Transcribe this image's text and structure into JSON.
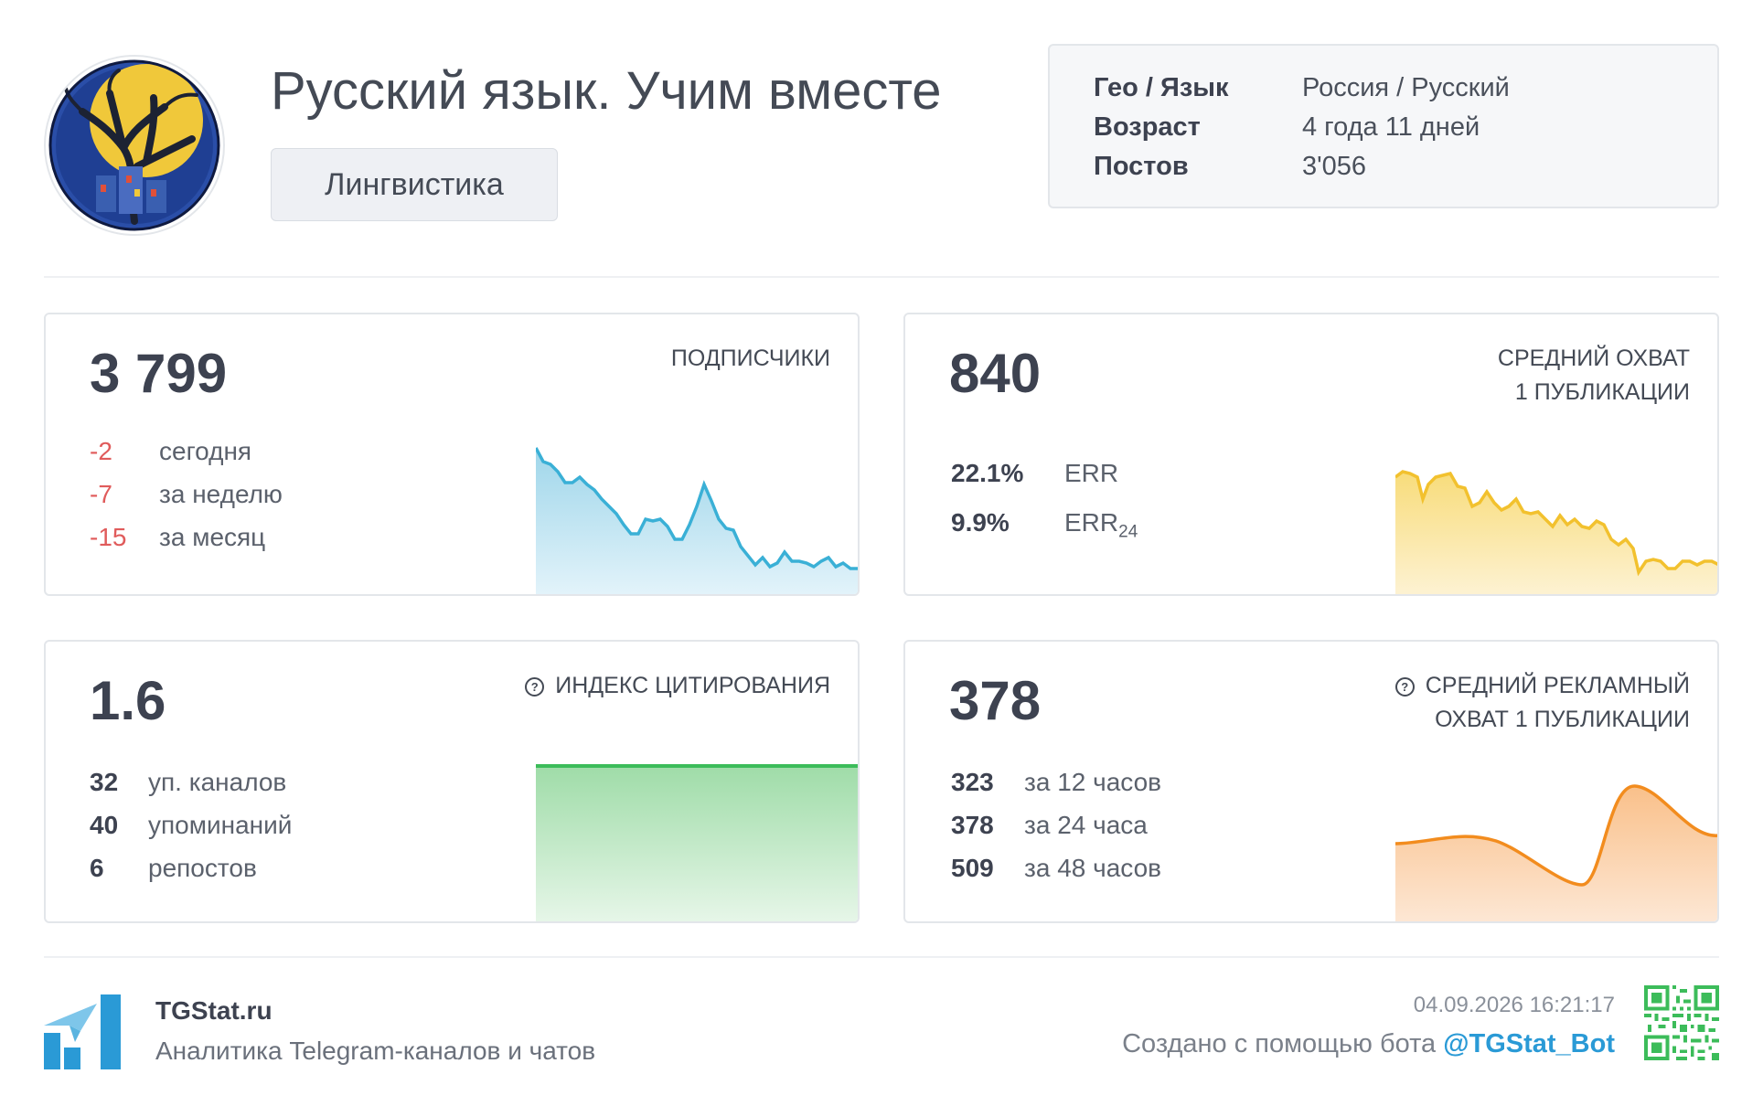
{
  "channel": {
    "title": "Русский язык. Учим вместе",
    "category": "Лингвистика"
  },
  "info": [
    {
      "key": "Гео / Язык",
      "value": "Россия / Русский"
    },
    {
      "key": "Возраст",
      "value": "4 года 11 дней"
    },
    {
      "key": "Постов",
      "value": "3'056"
    }
  ],
  "subscribers": {
    "value": "3 799",
    "title": "ПОДПИСЧИКИ",
    "changes": [
      {
        "delta": "-2",
        "label": "сегодня"
      },
      {
        "delta": "-7",
        "label": "за неделю"
      },
      {
        "delta": "-15",
        "label": "за месяц"
      }
    ],
    "color": "#3ab0d6"
  },
  "reach": {
    "value": "840",
    "title_line1": "СРЕДНИЙ ОХВАТ",
    "title_line2": "1 ПУБЛИКАЦИИ",
    "err": {
      "value": "22.1%",
      "label": "ERR"
    },
    "err24": {
      "value": "9.9%",
      "label": "ERR",
      "sub": "24"
    },
    "color": "#f2c12e"
  },
  "citation": {
    "value": "1.6",
    "title": "ИНДЕКС ЦИТИРОВАНИЯ",
    "stats": [
      {
        "num": "32",
        "label": "уп. каналов"
      },
      {
        "num": "40",
        "label": "упоминаний"
      },
      {
        "num": "6",
        "label": "репостов"
      }
    ],
    "color": "#3cbc5a"
  },
  "ad_reach": {
    "value": "378",
    "title_line1": "СРЕДНИЙ РЕКЛАМНЫЙ",
    "title_line2": "ОХВАТ 1 ПУБЛИКАЦИИ",
    "stats": [
      {
        "num": "323",
        "label": "за 12 часов"
      },
      {
        "num": "378",
        "label": "за 24 часа"
      },
      {
        "num": "509",
        "label": "за 48 часов"
      }
    ],
    "color": "#f28c1e"
  },
  "footer": {
    "brand": "TGStat.ru",
    "tagline": "Аналитика Telegram-каналов и чатов",
    "date": "04.09.2026 16:21:17",
    "created_prefix": "Создано с помощью бота ",
    "bot": "@TGStat_Bot"
  },
  "icons": [
    "channel-avatar",
    "help-icon",
    "tgstat-logo",
    "qr-code"
  ]
}
